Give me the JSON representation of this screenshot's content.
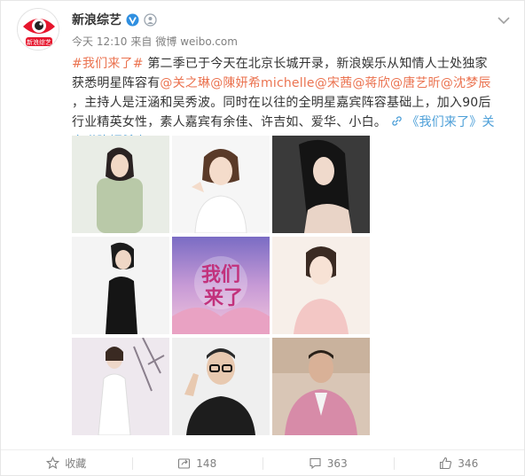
{
  "author": {
    "name": "新浪综艺",
    "avatar_text": "新浪综艺",
    "timestamp": "今天 12:10",
    "source_prefix": "来自",
    "source": "微博 weibo.com"
  },
  "post": {
    "seg1_hashtag": "#我们来了#",
    "seg2": " 第二季已于今天在北京长城开录，新浪娱乐从知情人士处独家获悉明星阵容有",
    "seg3_mention1": "@关之琳",
    "seg4_mention2": "@陳妍希michelle",
    "seg5_mention3": "@宋茜",
    "seg6_mention4": "@蒋欣",
    "seg7_mention5": "@唐艺昕",
    "seg8_mention6": "@沈梦辰",
    "seg9": " ，主持人是汪涵和吴秀波。同时在以往的全明星嘉宾阵容基础上，加入90后行业精英女性，素人嘉宾有余佳、许吉如、爱华、小白。",
    "seg10_link": "《我们来了》关之琳陈妍希上"
  },
  "images": {
    "poster_title_line1": "我们",
    "poster_title_line2": "来了"
  },
  "actions": {
    "favorite_label": "收藏",
    "repost_count": "148",
    "comment_count": "363",
    "like_count": "346"
  },
  "colors": {
    "link_orange": "#eb7350",
    "link_blue": "#4c9fd8",
    "meta_gray": "#808080",
    "brand_red": "#e6162d"
  }
}
